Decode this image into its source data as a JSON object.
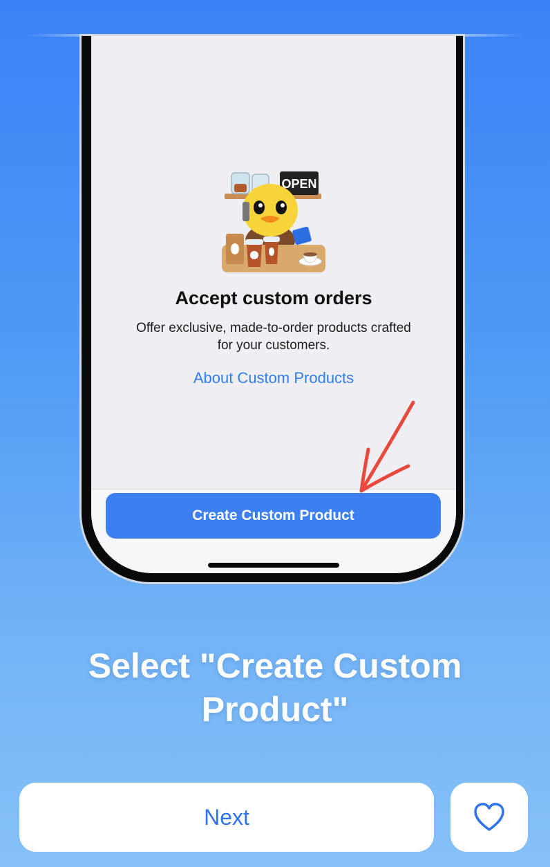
{
  "screen": {
    "title": "Accept custom orders",
    "description": "Offer exclusive, made-to-order products crafted for your customers.",
    "link": "About Custom Products",
    "primary_button": "Create Custom Product",
    "sign_text": "OPEN"
  },
  "instruction": {
    "headline": "Select \"Create Custom Product\""
  },
  "footer": {
    "next_label": "Next",
    "favorite_icon": "heart-outline-icon"
  },
  "colors": {
    "accent": "#3b7ff0",
    "link": "#2f7de8",
    "arrow": "#e9483c",
    "background_top": "#3b82f6",
    "background_bottom": "#86c0f8"
  }
}
